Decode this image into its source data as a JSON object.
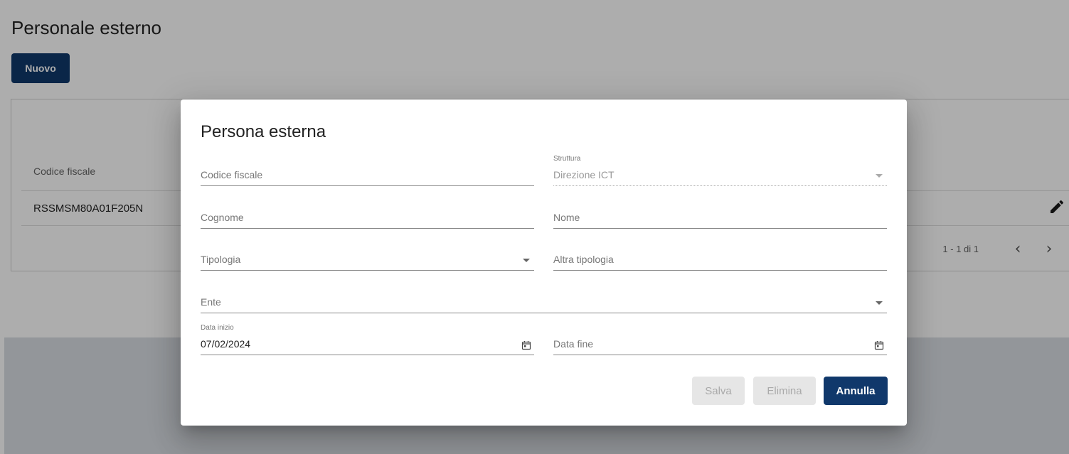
{
  "page": {
    "title": "Personale esterno",
    "new_button": "Nuovo"
  },
  "table": {
    "columns": [
      "Codice fiscale"
    ],
    "rows": [
      {
        "codice_fiscale": "RSSMSM80A01F205N"
      }
    ],
    "paginator": "1 - 1 di 1",
    "prev_icon": "chevron-left-icon",
    "next_icon": "chevron-right-icon",
    "edit_icon": "pencil-icon"
  },
  "dialog": {
    "title": "Persona esterna",
    "fields": {
      "codice_fiscale": {
        "placeholder": "Codice fiscale",
        "value": ""
      },
      "struttura": {
        "label": "Struttura",
        "value": "Direzione ICT",
        "disabled": true
      },
      "cognome": {
        "placeholder": "Cognome",
        "value": ""
      },
      "nome": {
        "placeholder": "Nome",
        "value": ""
      },
      "tipologia": {
        "placeholder": "Tipologia",
        "value": ""
      },
      "altra_tipologia": {
        "placeholder": "Altra tipologia",
        "value": ""
      },
      "ente": {
        "placeholder": "Ente",
        "value": ""
      },
      "data_inizio": {
        "label": "Data inizio",
        "value": "07/02/2024"
      },
      "data_fine": {
        "placeholder": "Data fine",
        "value": ""
      }
    },
    "buttons": {
      "save": "Salva",
      "delete": "Elimina",
      "cancel": "Annulla"
    }
  },
  "colors": {
    "primary": "#10386b",
    "disabled_bg": "#e6e6e6",
    "disabled_text": "#aaaaaa"
  }
}
